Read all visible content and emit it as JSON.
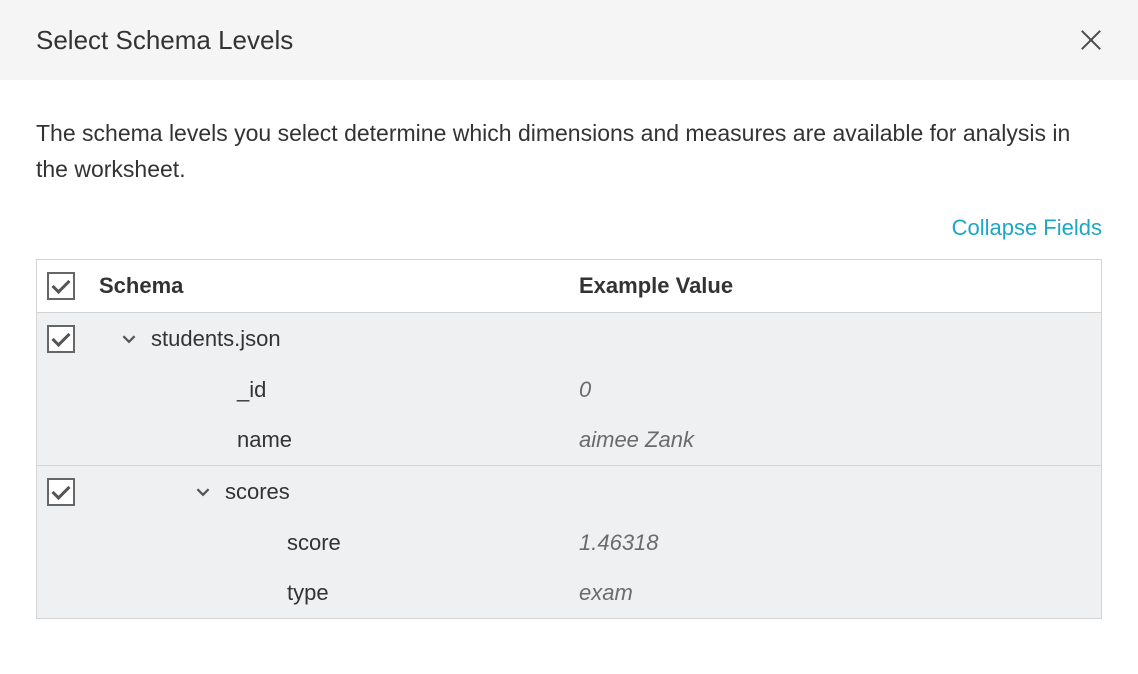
{
  "header": {
    "title": "Select Schema Levels"
  },
  "description": "The schema levels you select determine which dimensions and measures are available for analysis in the worksheet.",
  "collapse_link": "Collapse Fields",
  "table": {
    "columns": {
      "schema": "Schema",
      "example": "Example Value"
    }
  },
  "tree": {
    "root": {
      "name": "students.json",
      "checked": true,
      "fields": [
        {
          "name": "_id",
          "example": "0"
        },
        {
          "name": "name",
          "example": "aimee Zank"
        }
      ],
      "children": [
        {
          "name": "scores",
          "checked": true,
          "fields": [
            {
              "name": "score",
              "example": "1.46318"
            },
            {
              "name": "type",
              "example": "exam"
            }
          ]
        }
      ]
    }
  }
}
